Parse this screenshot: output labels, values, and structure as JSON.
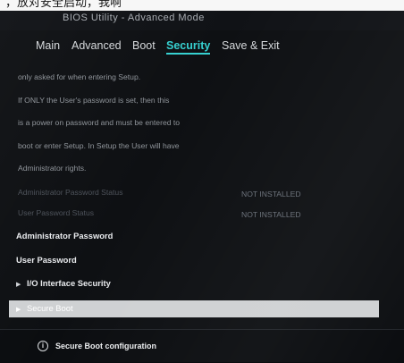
{
  "handwritten_top": "，放对安全启动，我啊",
  "header": {
    "title": "BIOS Utility - Advanced Mode"
  },
  "tabs": [
    {
      "label": "Main"
    },
    {
      "label": "Advanced"
    },
    {
      "label": "Boot"
    },
    {
      "label": "Security",
      "active": true
    },
    {
      "label": "Save & Exit"
    }
  ],
  "help_text": [
    "only asked for when entering Setup.",
    "If ONLY the User's password is set, then this",
    "is a power on password and must be entered to",
    "boot or enter Setup. In Setup the User will have",
    "Administrator rights."
  ],
  "status": [
    {
      "label": "Administrator Password Status",
      "value": "NOT INSTALLED"
    },
    {
      "label": "User Password Status",
      "value": "NOT INSTALLED"
    }
  ],
  "menu": {
    "admin_password": "Administrator Password",
    "user_password": "User Password",
    "io_interface_security": "I/O Interface Security",
    "secure_boot": "Secure Boot"
  },
  "footer": {
    "hint": "Secure Boot configuration"
  },
  "colors": {
    "accent": "#36d1d1",
    "selected_bg": "#cfd1d3",
    "background": "#0e1013"
  }
}
